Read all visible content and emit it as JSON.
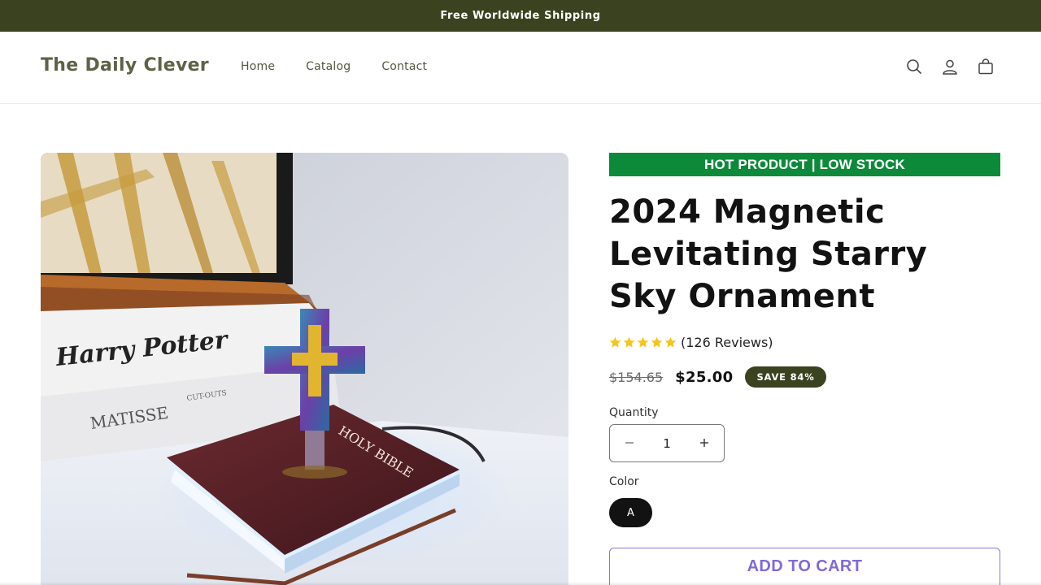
{
  "announcement": {
    "text": "Free Worldwide Shipping"
  },
  "header": {
    "logo": "The Daily Clever",
    "nav": [
      {
        "label": "Home"
      },
      {
        "label": "Catalog"
      },
      {
        "label": "Contact"
      }
    ],
    "icons": [
      "search-icon",
      "account-icon",
      "cart-icon"
    ]
  },
  "product": {
    "image_alt": "Magnetic levitating cross on Holy Bible lamp",
    "image_text": {
      "book1": "Harry Potter",
      "book2": "MATISSE",
      "book2_small": "CUT-OUTS",
      "bible": "HOLY BIBLE"
    },
    "hot_badge": "HOT PRODUCT | LOW STOCK",
    "title": "2024 Magnetic Levitating Starry Sky Ornament",
    "rating": {
      "stars": 5,
      "text": "(126 Reviews)"
    },
    "price_old": "$154.65",
    "price_new": "$25.00",
    "save_badge": "SAVE 84%",
    "quantity_label": "Quantity",
    "quantity_value": "1",
    "color_label": "Color",
    "color_options": [
      "A"
    ],
    "add_to_cart": "ADD TO CART"
  },
  "colors": {
    "announcement_bg": "#3b4220",
    "hot_badge_bg": "#0c8a3a",
    "star": "#f5c518",
    "add_to_cart": "#7f6ad6"
  }
}
